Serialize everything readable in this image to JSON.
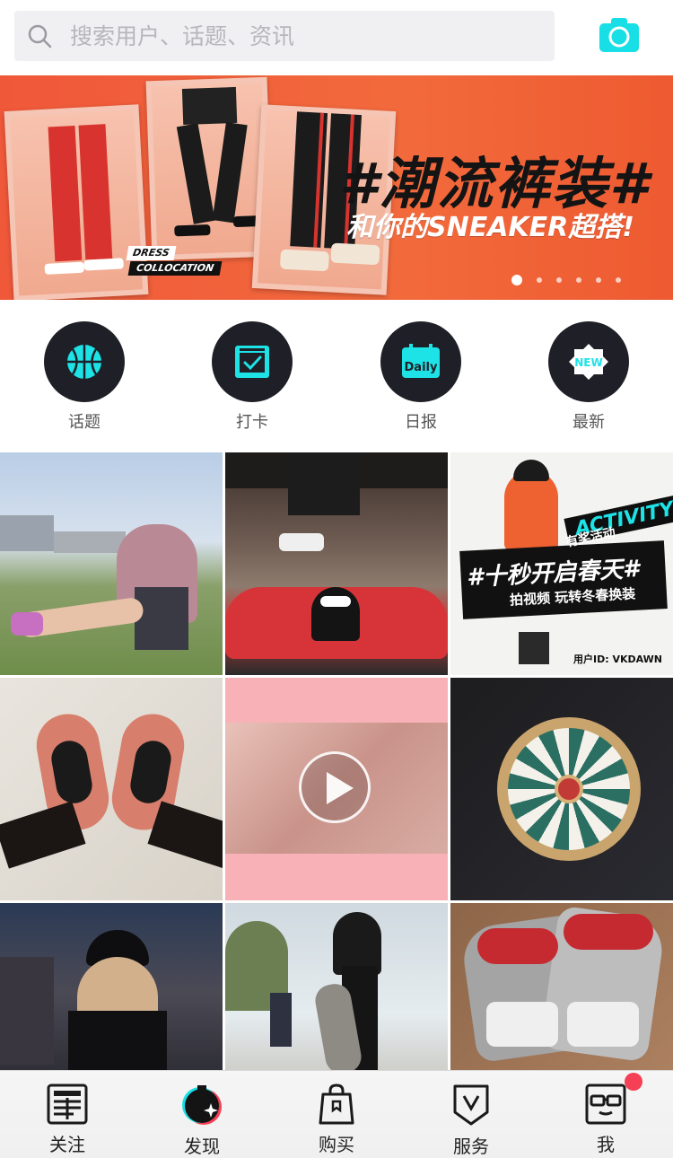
{
  "search": {
    "placeholder": "搜索用户、话题、资讯"
  },
  "banner": {
    "title": "#潮流裤装#",
    "subtitle": "和你的SNEAKER超搭!",
    "tag_line1": "DRESS",
    "tag_line2": "COLLOCATION",
    "slide_count": 6,
    "active_slide": 1
  },
  "quick_entries": [
    {
      "label": "话题",
      "icon": "basketball-icon"
    },
    {
      "label": "打卡",
      "icon": "checkin-icon"
    },
    {
      "label": "日报",
      "icon": "daily-calendar-icon"
    },
    {
      "label": "最新",
      "icon": "new-badge-icon"
    }
  ],
  "feed": {
    "activity": {
      "tag": "ACTIVITY",
      "tag_cn": "有奖活动",
      "title": "#十秒开启春天#",
      "subtitle": "拍视频 玩转冬春换装",
      "user": "用户ID: VKDAWN"
    }
  },
  "tabbar": {
    "items": [
      {
        "label": "关注",
        "icon": "follow-icon"
      },
      {
        "label": "发现",
        "icon": "discover-icon"
      },
      {
        "label": "购买",
        "icon": "shopping-bag-icon"
      },
      {
        "label": "服务",
        "icon": "service-icon"
      },
      {
        "label": "我",
        "icon": "profile-glasses-icon"
      }
    ],
    "active": 1,
    "badge_on": 4
  },
  "colors": {
    "accent": "#1de3e7",
    "banner_bg": "#f0583a",
    "icon_dark": "#1f1f27",
    "badge": "#f43f55"
  }
}
